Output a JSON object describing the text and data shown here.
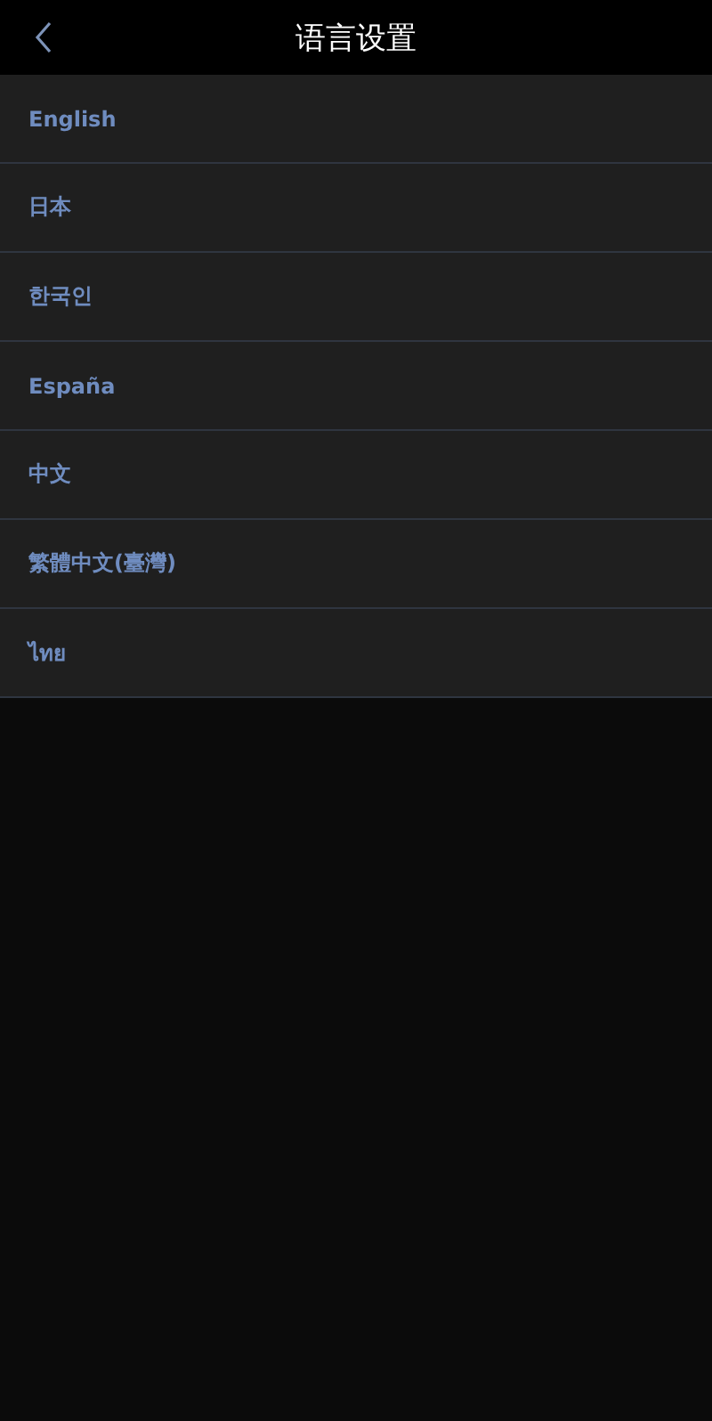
{
  "header": {
    "title": "语言设置"
  },
  "languages": [
    {
      "label": "English"
    },
    {
      "label": "日本"
    },
    {
      "label": "한국인"
    },
    {
      "label": "España"
    },
    {
      "label": "中文"
    },
    {
      "label": "繁體中文(臺灣)"
    },
    {
      "label": "ไทย"
    }
  ]
}
